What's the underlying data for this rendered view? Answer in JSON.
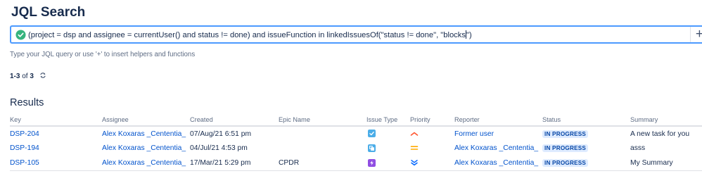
{
  "page": {
    "title": "JQL Search"
  },
  "query": {
    "value": "(project = dsp and assignee = currentUser() and status != done) and issueFunction in linkedIssuesOf(\"status != done\", \"blocks",
    "value_after_caret": "\")",
    "valid_icon": "check-circle-icon",
    "add_label": "+"
  },
  "hint": "Type your JQL query or use '+' to insert helpers and functions",
  "result_count": {
    "range": "1-3",
    "of_label": "of",
    "total": "3",
    "refresh_icon": "refresh-icon"
  },
  "results": {
    "heading": "Results",
    "columns": [
      "Key",
      "Assignee",
      "Created",
      "Epic Name",
      "Issue Type",
      "Priority",
      "Reporter",
      "Status",
      "Summary"
    ],
    "rows": [
      {
        "key": "DSP-204",
        "assignee": "Alex Koxaras _Cententia_",
        "created": "07/Aug/21 6:51 pm",
        "epic_name": "",
        "issue_type": "task",
        "issue_type_icon": "task-icon",
        "priority": "high",
        "priority_icon": "chevron-up-icon",
        "reporter": "Former user",
        "status": "IN PROGRESS",
        "summary": "A new task for you"
      },
      {
        "key": "DSP-194",
        "assignee": "Alex Koxaras _Cententia_",
        "created": "04/Jul/21 4:53 pm",
        "epic_name": "",
        "issue_type": "subtask",
        "issue_type_icon": "subtask-icon",
        "priority": "medium",
        "priority_icon": "equals-icon",
        "reporter": "Alex Koxaras _Cententia_",
        "status": "IN PROGRESS",
        "summary": "asss"
      },
      {
        "key": "DSP-105",
        "assignee": "Alex Koxaras _Cententia_",
        "created": "17/Mar/21 5:29 pm",
        "epic_name": "CPDR",
        "issue_type": "epic",
        "issue_type_icon": "epic-icon",
        "priority": "lowest",
        "priority_icon": "double-chevron-down-icon",
        "reporter": "Alex Koxaras _Cententia_",
        "status": "IN PROGRESS",
        "summary": "My Summary"
      }
    ]
  },
  "colors": {
    "link": "#0052cc",
    "valid": "#36b37e",
    "focus_border": "#4c9aff",
    "task": "#4bade8",
    "subtask": "#4bade8",
    "epic": "#904ee2",
    "priority_high": "#ff5630",
    "priority_medium": "#ffab00",
    "priority_lowest": "#0065ff",
    "status_bg": "#deebff",
    "status_text": "#0747a6"
  }
}
